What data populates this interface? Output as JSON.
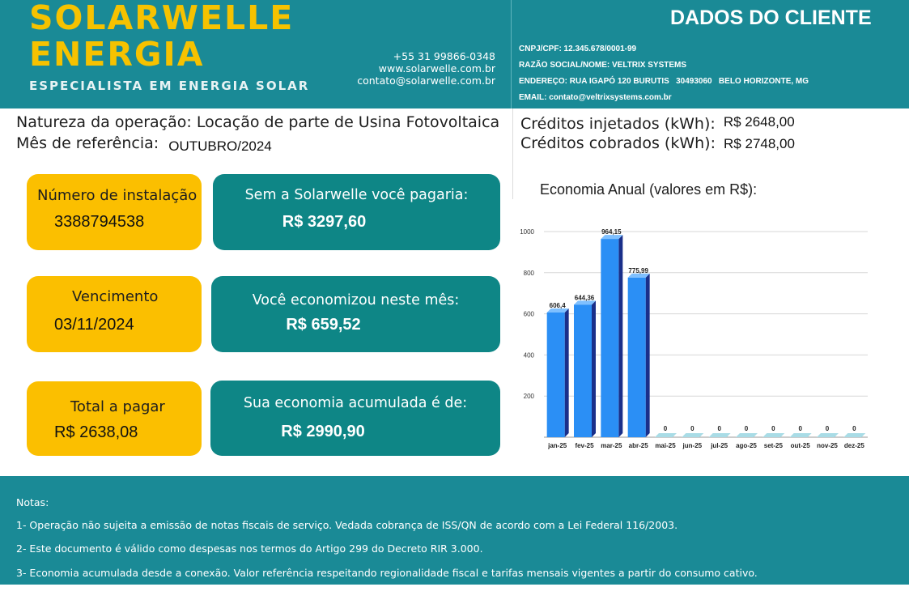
{
  "brand": {
    "name_line1": "SOLARWELLE",
    "name_line2": "ENERGIA",
    "tagline": "ESPECIALISTA EM ENERGIA SOLAR",
    "phone": "+55 31 99866-0348",
    "website": "www.solarwelle.com.br",
    "email": "contato@solarwelle.com.br",
    "color": "#f6c200"
  },
  "client": {
    "title": "DADOS DO CLIENTE",
    "cnpj": "CNPJ/CPF: 12.345.678/0001-99",
    "name": "RAZÃO SOCIAL/NOME: VELTRIX SYSTEMS",
    "address": "ENDEREÇO: RUA IGAPÓ 120 BURUTIS   30493060   BELO HORIZONTE, MG",
    "email": "EMAIL: contato@veltrixsystems.com.br"
  },
  "operation": {
    "nature_label": "Natureza da operação: Locação de parte de Usina Fotovoltaica",
    "month_label": "Mês de referência:",
    "month_value": "OUTUBRO/2024",
    "injected_label": "Créditos injetados (kWh):",
    "injected_value": "R$ 2648,00",
    "charged_label": "Créditos cobrados (kWh):",
    "charged_value": "R$ 2748,00"
  },
  "cards": {
    "installation_label": "Número de instalação",
    "installation_value": "3388794538",
    "due_label": "Vencimento",
    "due_value": "03/11/2024",
    "total_label": "Total a pagar",
    "total_value": "R$ 2638,08",
    "without_label": "Sem a Solarwelle você pagaria:",
    "without_value": "R$ 3297,60",
    "saved_label": "Você economizou neste mês:",
    "saved_value": "R$ 659,52",
    "accum_label": "Sua economia acumulada é de:",
    "accum_value": "R$ 2990,90"
  },
  "chart_title": "Economia Anual (valores em R$):",
  "chart_data": {
    "type": "bar",
    "title": "Economia Anual (valores em R$):",
    "categories": [
      "jan-25",
      "fev-25",
      "mar-25",
      "abr-25",
      "mai-25",
      "jun-25",
      "jul-25",
      "ago-25",
      "set-25",
      "out-25",
      "nov-25",
      "dez-25"
    ],
    "values": [
      606.4,
      644.36,
      964.15,
      775.99,
      0,
      0,
      0,
      0,
      0,
      0,
      0,
      0
    ],
    "data_labels": [
      "606,4",
      "644,36",
      "964,15",
      "775,99",
      "0",
      "0",
      "0",
      "0",
      "0",
      "0",
      "0",
      "0"
    ],
    "yticks": [
      "200",
      "400",
      "600",
      "800",
      "1000"
    ],
    "ylim": [
      0,
      1000
    ],
    "grid": true,
    "bar_color": "#2b8ff5",
    "bar_side_color": "#1a2f8a",
    "zero_bar_color": "#a9dce6"
  },
  "notes": {
    "title": "Notas:",
    "items": [
      "1- Operação não sujeita a emissão de notas fiscais de serviço. Vedada cobrança de ISS/QN de acordo com a Lei Federal 116/2003.",
      "2- Este documento é válido como despesas nos termos do Artigo 299 do Decreto RIR 3.000.",
      "3- Economia acumulada desde a conexão. Valor referência respeitando regionalidade fiscal e tarifas mensais vigentes a partir do consumo cativo."
    ]
  }
}
